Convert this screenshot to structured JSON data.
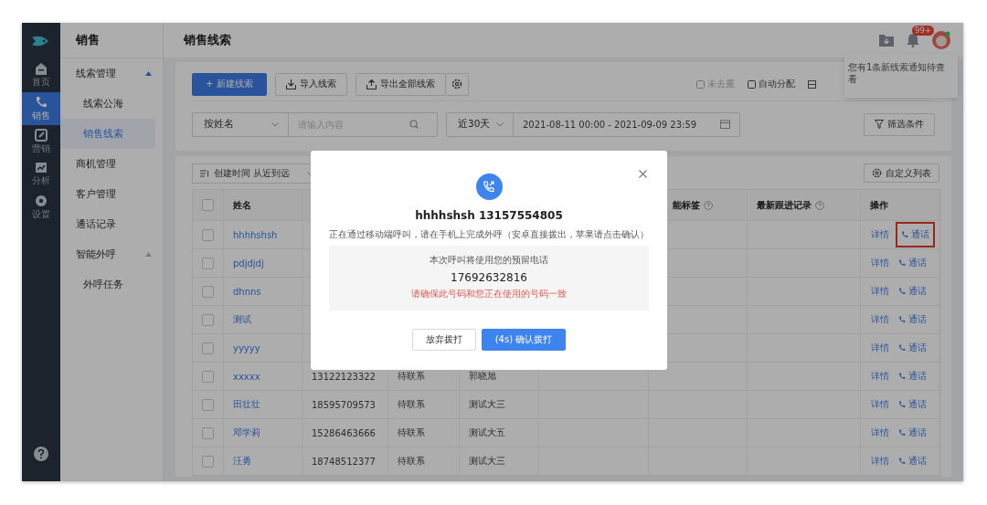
{
  "rail": {
    "items": [
      {
        "label": "首页",
        "selected": false
      },
      {
        "label": "销售",
        "selected": true
      },
      {
        "label": "营销",
        "selected": false
      },
      {
        "label": "分析",
        "selected": false
      },
      {
        "label": "设置",
        "selected": false
      }
    ]
  },
  "sidebar": {
    "title": "销售",
    "items": [
      {
        "label": "线索管理",
        "expanded": true,
        "selected": false,
        "children": [
          {
            "label": "线索公海",
            "selected": false
          },
          {
            "label": "销售线索",
            "selected": true
          }
        ]
      },
      {
        "label": "商机管理",
        "selected": false
      },
      {
        "label": "客户管理",
        "selected": false
      },
      {
        "label": "通话记录",
        "selected": false
      },
      {
        "label": "智能外呼",
        "expanded": true,
        "selected": false,
        "children": [
          {
            "label": "外呼任务",
            "selected": false
          }
        ]
      }
    ]
  },
  "header": {
    "title": "销售线索",
    "badge": "99+"
  },
  "notification": "您有1条新线索通知待查看",
  "toolbar": {
    "new_button": "+ 新建线索",
    "import_button": "导入线索",
    "export_button": "导出全部线索",
    "right_links": [
      {
        "label": "未去重",
        "disabled": true
      },
      {
        "label": "自动分配",
        "disabled": false
      }
    ]
  },
  "filters": {
    "field_select": "按姓名",
    "search": {
      "placeholder": "请输入内容"
    },
    "range_select": "近30天",
    "date_range": "2021-08-11 00:00 - 2021-09-09 23:59",
    "filter_button": "筛选条件"
  },
  "table": {
    "sort": "创建时间 从近到远",
    "columns_button": "自定义列表",
    "all_checked": false,
    "columns": [
      "姓名",
      "",
      "",
      "",
      "",
      "能标签",
      "最新跟进记录",
      "操作"
    ],
    "rows": [
      {
        "checked": false,
        "name": "hhhhshsh",
        "phone": "",
        "status": "",
        "owner": "",
        "detail": "详情",
        "call": "通话",
        "highlighted": true
      },
      {
        "checked": false,
        "name": "pdjdjdj",
        "phone": "",
        "status": "",
        "owner": "",
        "detail": "详情",
        "call": "通话",
        "highlighted": false
      },
      {
        "checked": false,
        "name": "dhnns",
        "phone": "",
        "status": "",
        "owner": "",
        "detail": "详情",
        "call": "通话",
        "highlighted": false
      },
      {
        "checked": false,
        "name": "测试",
        "phone": "",
        "status": "",
        "owner": "",
        "detail": "详情",
        "call": "通话",
        "highlighted": false
      },
      {
        "checked": false,
        "name": "yyyyy",
        "phone": "",
        "status": "",
        "owner": "",
        "detail": "详情",
        "call": "通话",
        "highlighted": false
      },
      {
        "checked": false,
        "name": "xxxxx",
        "phone": "13122123322",
        "status": "待联系",
        "owner": "郭晓旭",
        "detail": "详情",
        "call": "通话",
        "highlighted": false
      },
      {
        "checked": false,
        "name": "田壮壮",
        "phone": "18595709573",
        "status": "待联系",
        "owner": "测试大三",
        "detail": "详情",
        "call": "通话",
        "highlighted": false
      },
      {
        "checked": false,
        "name": "邓学莉",
        "phone": "15286463666",
        "status": "待联系",
        "owner": "测试大五",
        "detail": "详情",
        "call": "通话",
        "highlighted": false
      },
      {
        "checked": false,
        "name": "汪勇",
        "phone": "18748512377",
        "status": "待联系",
        "owner": "测试大三",
        "detail": "详情",
        "call": "通话",
        "highlighted": false
      }
    ]
  },
  "dialog": {
    "title": "hhhhshsh 13157554805",
    "message": "正在通过移动端呼叫，请在手机上完成外呼（安卓直接拨出，苹果请点击确认）",
    "note": "本次呼叫将使用您的预留电话",
    "number": "17692632816",
    "warning": "请确保此号码和您正在使用的号码一致",
    "cancel": "放弃拨打",
    "confirm": "(4s) 确认拨打"
  }
}
